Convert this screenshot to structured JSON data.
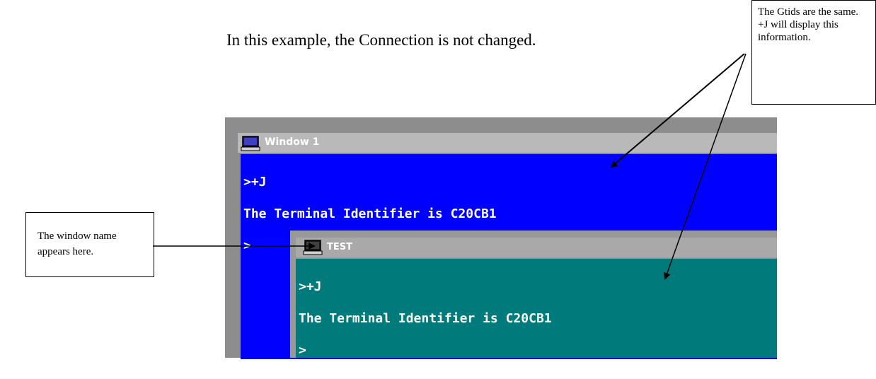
{
  "heading": "In this example, the Connection is not changed.",
  "window1": {
    "title": "Window 1",
    "icon": "computer-icon",
    "lines": [
      ">+J",
      "The Terminal Identifier is C20CB1",
      ">"
    ],
    "screen_color": "#0000ff"
  },
  "window2": {
    "title": "TEST",
    "icon": "computer-icon",
    "lines": [
      ">+J",
      "The Terminal Identifier is C20CB1",
      ">"
    ],
    "screen_color": "#007a7a"
  },
  "callouts": {
    "top": "The Gtids are the same. +J will display this information.",
    "left": "The window name appears here."
  }
}
